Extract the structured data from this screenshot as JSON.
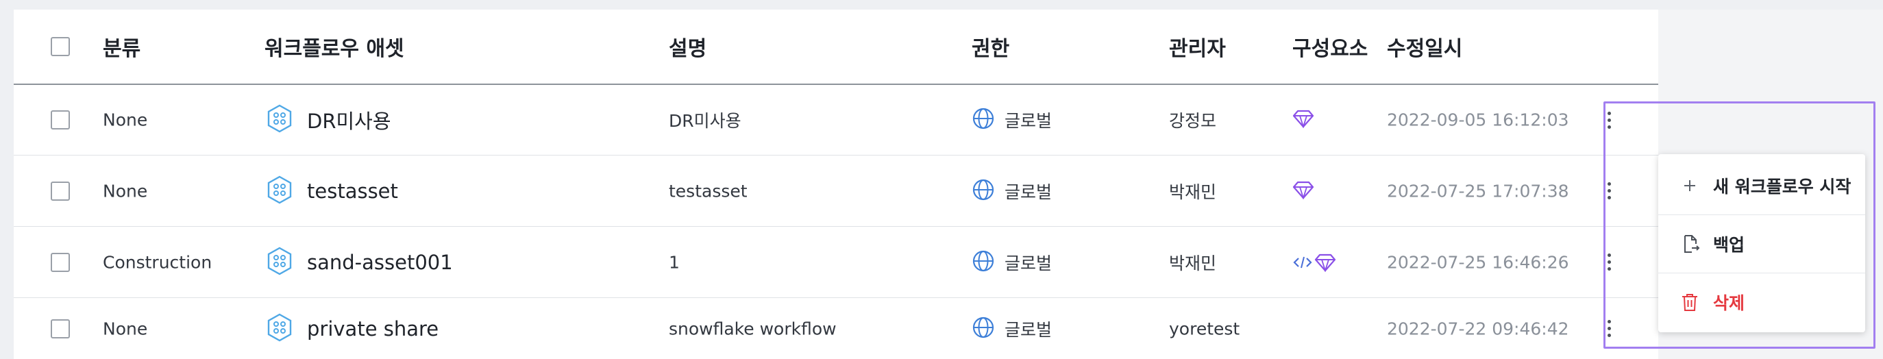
{
  "columns": {
    "category": "분류",
    "asset": "워크플로우 애셋",
    "description": "설명",
    "permission": "권한",
    "manager": "관리자",
    "components": "구성요소",
    "modified": "수정일시"
  },
  "rows": [
    {
      "category": "None",
      "name": "DR미사용",
      "description": "DR미사용",
      "permission": "글로벌",
      "manager": "강정모",
      "components": [
        "gem-icon"
      ],
      "modified": "2022-09-05 16:12:03"
    },
    {
      "category": "None",
      "name": "testasset",
      "description": "testasset",
      "permission": "글로벌",
      "manager": "박재민",
      "components": [
        "gem-icon"
      ],
      "modified": "2022-07-25 17:07:38"
    },
    {
      "category": "Construction",
      "name": "sand-asset001",
      "description": "1",
      "permission": "글로벌",
      "manager": "박재민",
      "components": [
        "code-icon",
        "gem-icon"
      ],
      "modified": "2022-07-25 16:46:26"
    },
    {
      "category": "None",
      "name": "private share",
      "description": "snowflake workflow",
      "permission": "글로벌",
      "manager": "yoretest",
      "components": [],
      "modified": "2022-07-22 09:46:42"
    }
  ],
  "context_menu": {
    "items": [
      {
        "label": "새 워크플로우 시작",
        "icon": "plus-icon"
      },
      {
        "label": "백업",
        "icon": "backup-file-icon"
      },
      {
        "label": "삭제",
        "icon": "trash-icon",
        "color": "#e5393f"
      }
    ]
  },
  "colors": {
    "asset_icon": "#4fa8e6",
    "globe_icon": "#3d7fd8",
    "gem_icon": "#8a4fe8",
    "highlight": "#a27ff0",
    "delete": "#e5393f"
  }
}
